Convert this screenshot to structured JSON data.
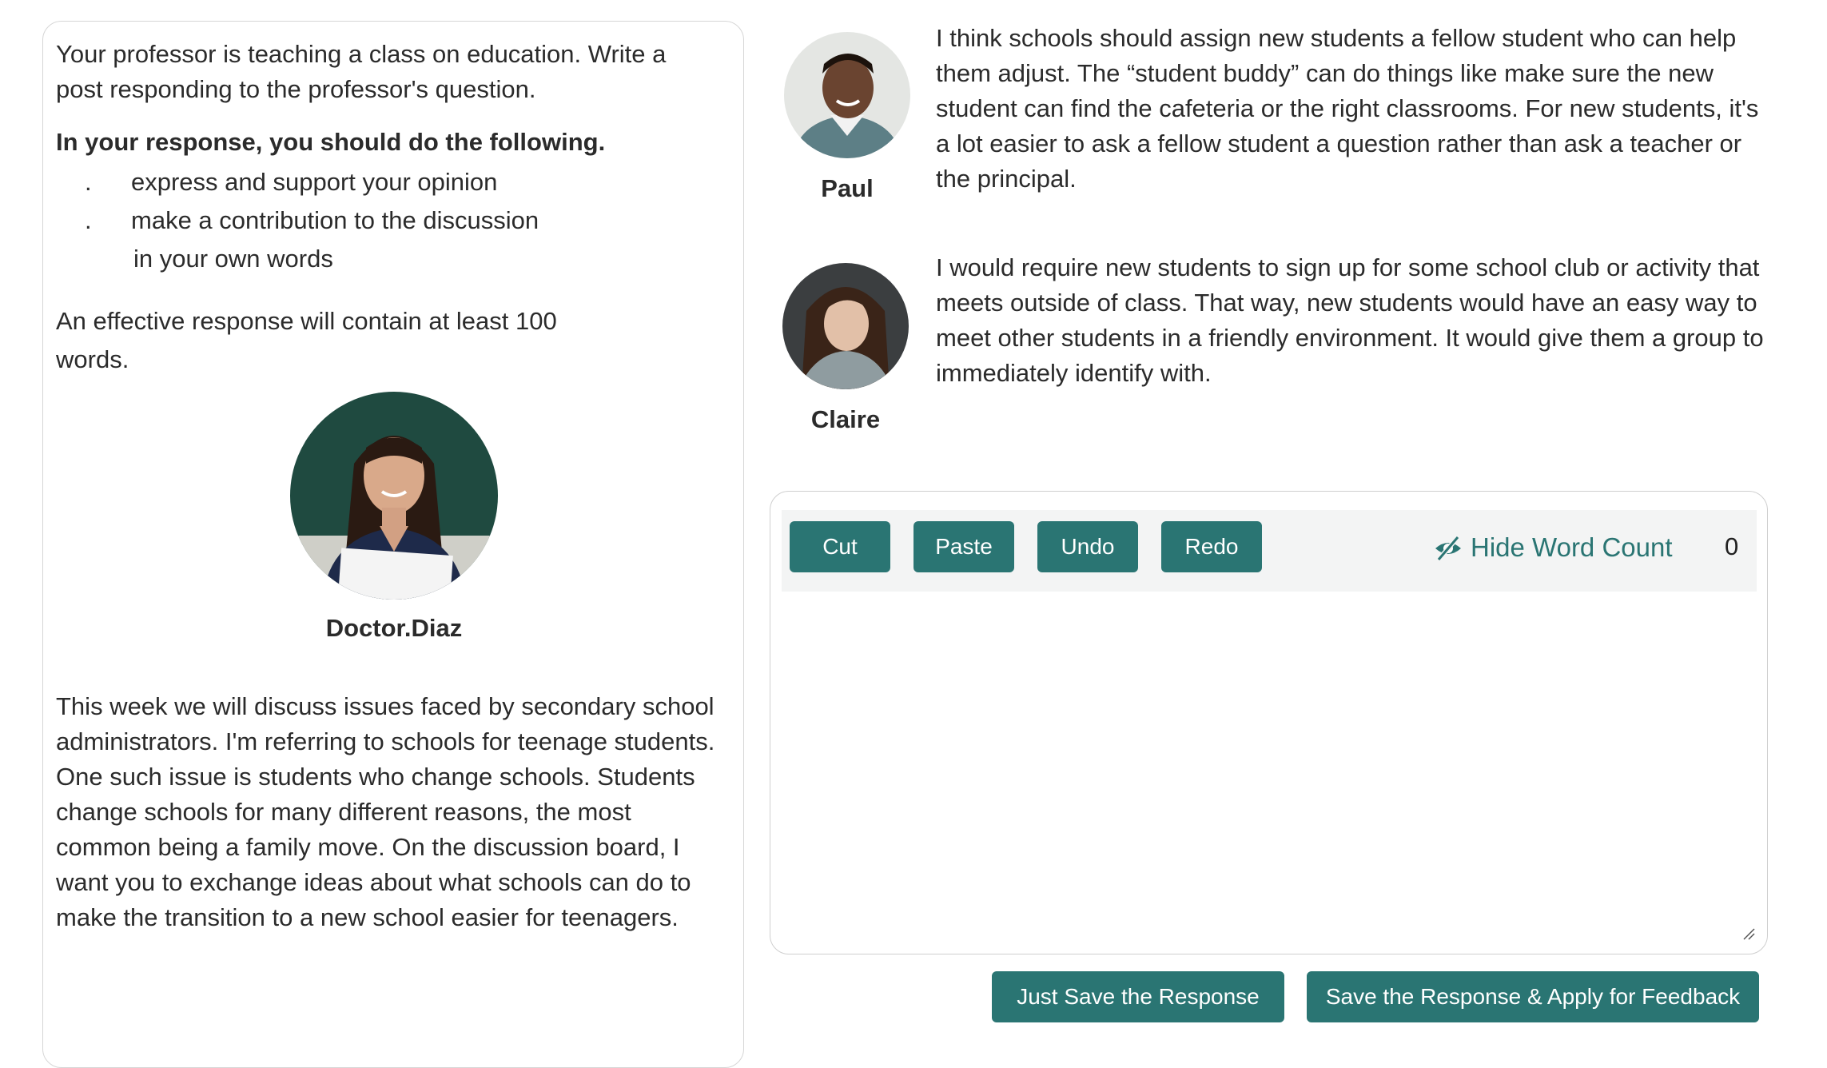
{
  "instructions": {
    "intro": "Your professor is teaching a class on education. Write a post responding to the professor's question.",
    "heading": "In your response, you should do the following.",
    "bullets": [
      "express and support your opinion",
      "make a contribution to the discussion"
    ],
    "bullet_continuation": "in your own words",
    "bullet_marker": ".",
    "effective": "An effective response will contain at least 100 words."
  },
  "professor": {
    "name": "Doctor.Diaz",
    "text": "This week we will discuss issues faced by secondary school administrators. I'm referring to schools for teenage students. One such issue is students who change schools. Students change schools for many different reasons, the most common being a family move. On the discussion board, I want you to exchange ideas about what schools can do to make the transition to a new school easier for teenagers."
  },
  "posts": [
    {
      "name": "Paul",
      "text": "I think schools should assign new students a fellow student who can help them adjust. The “student buddy” can do things like make sure the new student can find the cafeteria or the right classrooms. For new students, it's a lot easier to ask a fellow student a question rather than ask a teacher or the principal."
    },
    {
      "name": "Claire",
      "text": "I would require new students to sign up for some school club or activity that meets outside of class. That way, new students would have an easy way to meet other students in a friendly environment. It would give them a group to immediately identify with."
    }
  ],
  "editor": {
    "buttons": {
      "cut": "Cut",
      "paste": "Paste",
      "undo": "Undo",
      "redo": "Redo"
    },
    "hide_word_count": "Hide Word Count",
    "word_count": "0",
    "response_value": ""
  },
  "actions": {
    "save": "Just Save the Response",
    "save_feedback": "Save the Response & Apply for Feedback"
  },
  "colors": {
    "accent": "#2a7573"
  },
  "icons": {
    "hide_word_count": "eye-slash-icon",
    "resize": "resize-grip-icon"
  }
}
